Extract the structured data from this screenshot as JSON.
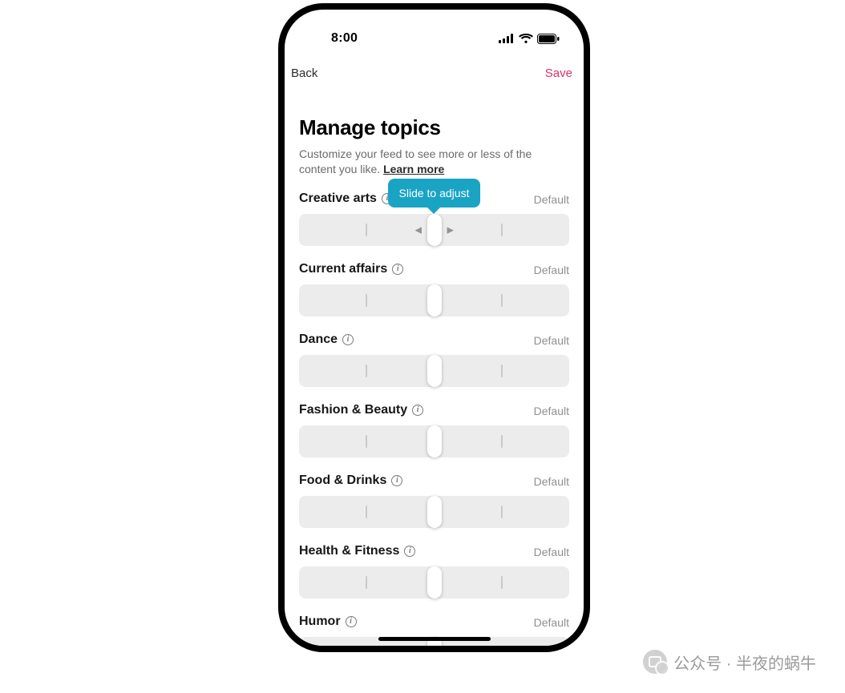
{
  "status": {
    "time": "8:00"
  },
  "nav": {
    "back": "Back",
    "save": "Save"
  },
  "header": {
    "title": "Manage topics",
    "desc_prefix": "Customize your feed to see more or less of the content you like. ",
    "learn_more": "Learn more"
  },
  "tooltip": "Slide to adjust",
  "state_label": "Default",
  "info_glyph": "i",
  "topics": [
    {
      "name": "Creative arts",
      "show_arrows": true,
      "show_tooltip": true
    },
    {
      "name": "Current affairs",
      "show_arrows": false,
      "show_tooltip": false
    },
    {
      "name": "Dance",
      "show_arrows": false,
      "show_tooltip": false
    },
    {
      "name": "Fashion & Beauty",
      "show_arrows": false,
      "show_tooltip": false
    },
    {
      "name": "Food & Drinks",
      "show_arrows": false,
      "show_tooltip": false
    },
    {
      "name": "Health & Fitness",
      "show_arrows": false,
      "show_tooltip": false
    },
    {
      "name": "Humor",
      "show_arrows": false,
      "show_tooltip": false
    }
  ],
  "watermark": "公众号 · 半夜的蜗牛"
}
